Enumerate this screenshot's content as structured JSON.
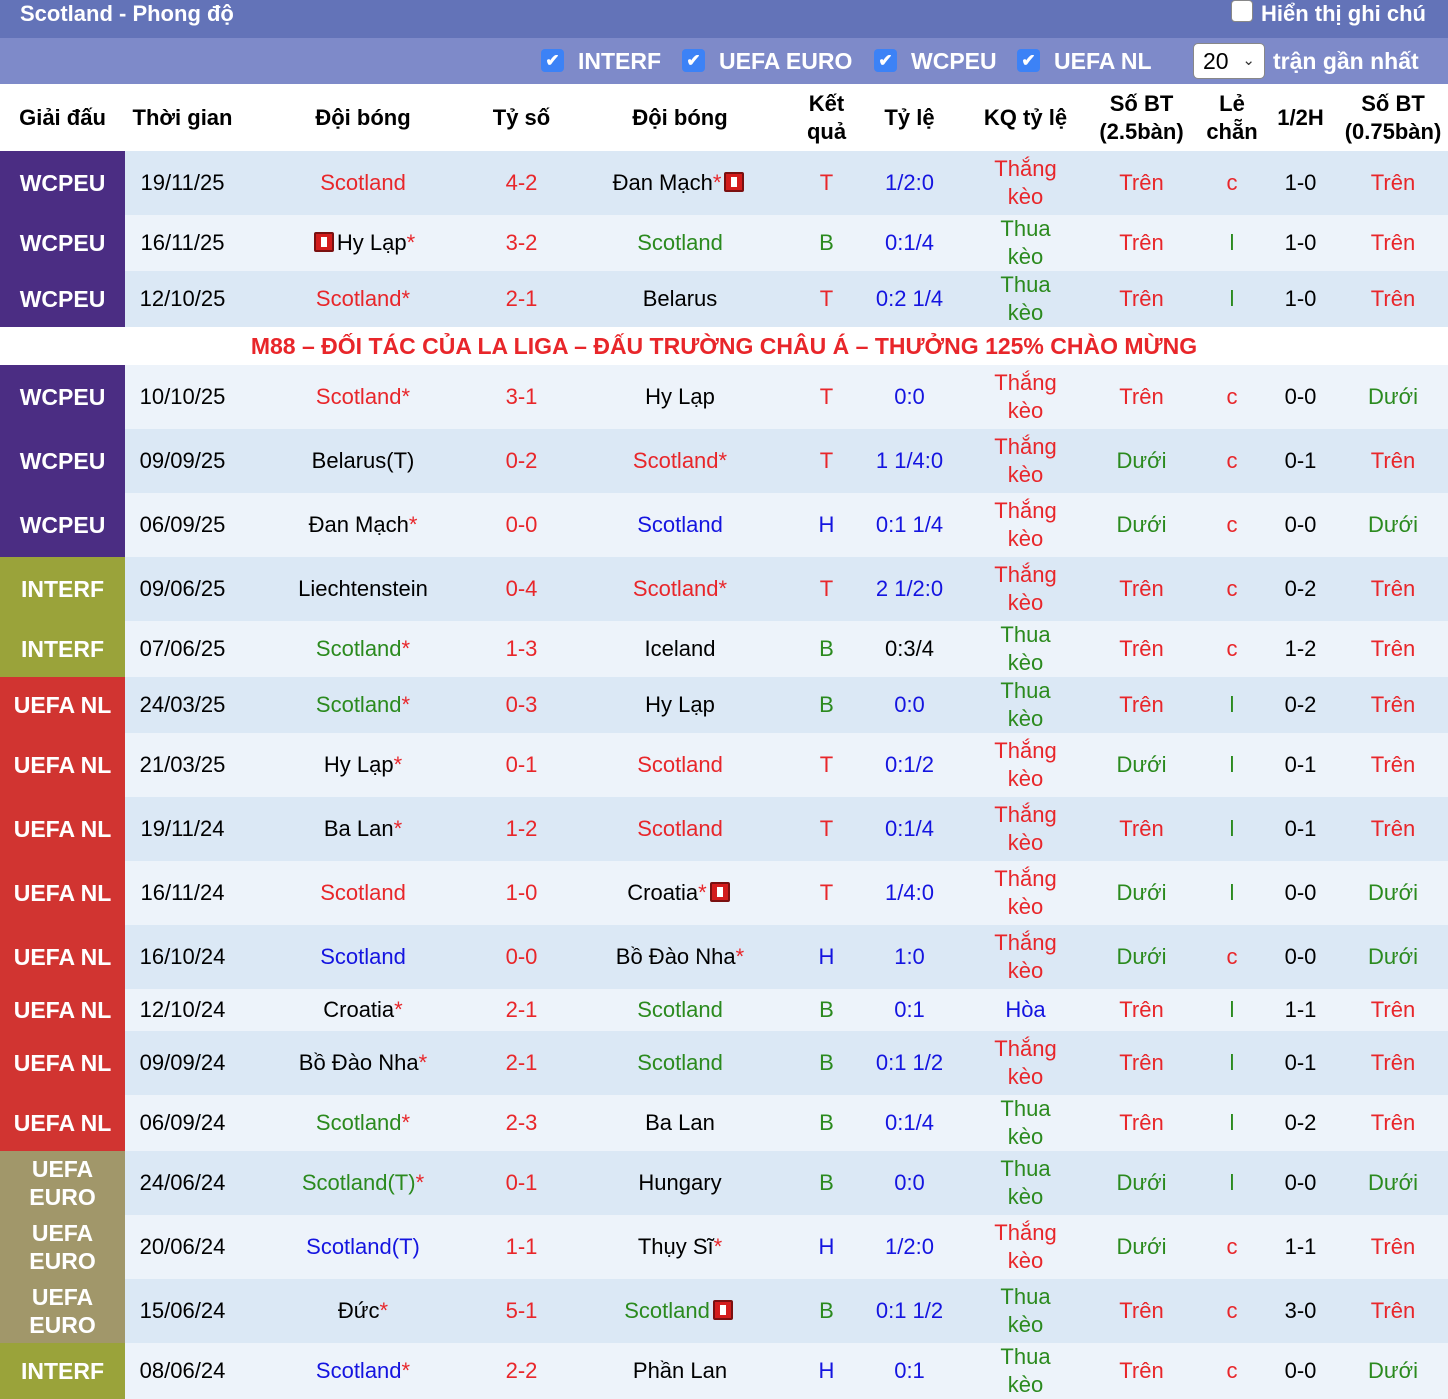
{
  "header": {
    "title": "Scotland - Phong độ",
    "show_notes": "Hiển thị ghi chú"
  },
  "filters": [
    {
      "label": "INTERF",
      "checked": true
    },
    {
      "label": "UEFA EURO",
      "checked": true
    },
    {
      "label": "WCPEU",
      "checked": true
    },
    {
      "label": "UEFA NL",
      "checked": true
    }
  ],
  "recent": {
    "value": "20",
    "label": "trận gần nhất"
  },
  "columns": [
    "Giải đấu",
    "Thời gian",
    "Đội bóng",
    "Tỷ số",
    "Đội bóng",
    "Kết quả",
    "Tỷ lệ",
    "KQ tỷ lệ",
    "Số BT (2.5bàn)",
    "Lẻ chẵn",
    "1/2H",
    "Số BT (0.75bàn)"
  ],
  "colors": {
    "WCPEU": "#4b2d83",
    "INTERF": "#9aa33a",
    "UEFA NL": "#d13431",
    "UEFA EURO": "#a1976a",
    "red": "#e8262a",
    "green": "#2b8a1e",
    "blue": "#1414e0"
  },
  "promo": "M88 – ĐỐI TÁC CỦA LA LIGA – ĐẤU TRƯỜNG CHÂU Á – THƯỞNG 125% CHÀO MỪNG",
  "matches": [
    {
      "comp": "WCPEU",
      "date": "19/11/25",
      "home": "Scotland",
      "hc": "red",
      "hs": "",
      "hcard": false,
      "score": "4-2",
      "away": "Đan Mạch",
      "ac": "black",
      "as": "*",
      "acard": true,
      "res": "T",
      "odds": "1/2:0",
      "oc": "blue",
      "kq": "Thắng kèo",
      "kc": "red",
      "bt": "Trên",
      "btc": "red",
      "lc": "c",
      "h1": "1-0",
      "bt2": "Trên",
      "bt2c": "red"
    },
    {
      "comp": "WCPEU",
      "date": "16/11/25",
      "home": "Hy Lạp",
      "hc": "black",
      "hs": "*",
      "hcard": true,
      "score": "3-2",
      "away": "Scotland",
      "ac": "green",
      "as": "",
      "acard": false,
      "res": "B",
      "odds": "0:1/4",
      "oc": "blue",
      "kq": "Thua kèo",
      "kc": "green",
      "bt": "Trên",
      "btc": "red",
      "lc": "l",
      "h1": "1-0",
      "bt2": "Trên",
      "bt2c": "red"
    },
    {
      "comp": "WCPEU",
      "date": "12/10/25",
      "home": "Scotland",
      "hc": "red",
      "hs": "*",
      "hcard": false,
      "score": "2-1",
      "away": "Belarus",
      "ac": "black",
      "as": "",
      "acard": false,
      "res": "T",
      "odds": "0:2 1/4",
      "oc": "blue",
      "kq": "Thua kèo",
      "kc": "green",
      "bt": "Trên",
      "btc": "red",
      "lc": "l",
      "h1": "1-0",
      "bt2": "Trên",
      "bt2c": "red"
    },
    {
      "comp": "WCPEU",
      "date": "10/10/25",
      "home": "Scotland",
      "hc": "red",
      "hs": "*",
      "hcard": false,
      "score": "3-1",
      "away": "Hy Lạp",
      "ac": "black",
      "as": "",
      "acard": false,
      "res": "T",
      "odds": "0:0",
      "oc": "blue",
      "kq": "Thắng kèo",
      "kc": "red",
      "bt": "Trên",
      "btc": "red",
      "lc": "c",
      "h1": "0-0",
      "bt2": "Dưới",
      "bt2c": "green"
    },
    {
      "comp": "WCPEU",
      "date": "09/09/25",
      "home": "Belarus(T)",
      "hc": "black",
      "hs": "",
      "hcard": false,
      "score": "0-2",
      "away": "Scotland",
      "ac": "red",
      "as": "*",
      "acard": false,
      "res": "T",
      "odds": "1 1/4:0",
      "oc": "blue",
      "kq": "Thắng kèo",
      "kc": "red",
      "bt": "Dưới",
      "btc": "green",
      "lc": "c",
      "h1": "0-1",
      "bt2": "Trên",
      "bt2c": "red"
    },
    {
      "comp": "WCPEU",
      "date": "06/09/25",
      "home": "Đan Mạch",
      "hc": "black",
      "hs": "*",
      "hcard": false,
      "score": "0-0",
      "away": "Scotland",
      "ac": "blue",
      "as": "",
      "acard": false,
      "res": "H",
      "odds": "0:1 1/4",
      "oc": "blue",
      "kq": "Thắng kèo",
      "kc": "red",
      "bt": "Dưới",
      "btc": "green",
      "lc": "c",
      "h1": "0-0",
      "bt2": "Dưới",
      "bt2c": "green"
    },
    {
      "comp": "INTERF",
      "date": "09/06/25",
      "home": "Liechtenstein",
      "hc": "black",
      "hs": "",
      "hcard": false,
      "score": "0-4",
      "away": "Scotland",
      "ac": "red",
      "as": "*",
      "acard": false,
      "res": "T",
      "odds": "2 1/2:0",
      "oc": "blue",
      "kq": "Thắng kèo",
      "kc": "red",
      "bt": "Trên",
      "btc": "red",
      "lc": "c",
      "h1": "0-2",
      "bt2": "Trên",
      "bt2c": "red"
    },
    {
      "comp": "INTERF",
      "date": "07/06/25",
      "home": "Scotland",
      "hc": "green",
      "hs": "*",
      "hcard": false,
      "score": "1-3",
      "away": "Iceland",
      "ac": "black",
      "as": "",
      "acard": false,
      "res": "B",
      "odds": "0:3/4",
      "oc": "black",
      "kq": "Thua kèo",
      "kc": "green",
      "bt": "Trên",
      "btc": "red",
      "lc": "c",
      "h1": "1-2",
      "bt2": "Trên",
      "bt2c": "red"
    },
    {
      "comp": "UEFA NL",
      "date": "24/03/25",
      "home": "Scotland",
      "hc": "green",
      "hs": "*",
      "hcard": false,
      "score": "0-3",
      "away": "Hy Lạp",
      "ac": "black",
      "as": "",
      "acard": false,
      "res": "B",
      "odds": "0:0",
      "oc": "blue",
      "kq": "Thua kèo",
      "kc": "green",
      "bt": "Trên",
      "btc": "red",
      "lc": "l",
      "h1": "0-2",
      "bt2": "Trên",
      "bt2c": "red"
    },
    {
      "comp": "UEFA NL",
      "date": "21/03/25",
      "home": "Hy Lạp",
      "hc": "black",
      "hs": "*",
      "hcard": false,
      "score": "0-1",
      "away": "Scotland",
      "ac": "red",
      "as": "",
      "acard": false,
      "res": "T",
      "odds": "0:1/2",
      "oc": "blue",
      "kq": "Thắng kèo",
      "kc": "red",
      "bt": "Dưới",
      "btc": "green",
      "lc": "l",
      "h1": "0-1",
      "bt2": "Trên",
      "bt2c": "red"
    },
    {
      "comp": "UEFA NL",
      "date": "19/11/24",
      "home": "Ba Lan",
      "hc": "black",
      "hs": "*",
      "hcard": false,
      "score": "1-2",
      "away": "Scotland",
      "ac": "red",
      "as": "",
      "acard": false,
      "res": "T",
      "odds": "0:1/4",
      "oc": "blue",
      "kq": "Thắng kèo",
      "kc": "red",
      "bt": "Trên",
      "btc": "red",
      "lc": "l",
      "h1": "0-1",
      "bt2": "Trên",
      "bt2c": "red"
    },
    {
      "comp": "UEFA NL",
      "date": "16/11/24",
      "home": "Scotland",
      "hc": "red",
      "hs": "",
      "hcard": false,
      "score": "1-0",
      "away": "Croatia",
      "ac": "black",
      "as": "*",
      "acard": true,
      "res": "T",
      "odds": "1/4:0",
      "oc": "blue",
      "kq": "Thắng kèo",
      "kc": "red",
      "bt": "Dưới",
      "btc": "green",
      "lc": "l",
      "h1": "0-0",
      "bt2": "Dưới",
      "bt2c": "green"
    },
    {
      "comp": "UEFA NL",
      "date": "16/10/24",
      "home": "Scotland",
      "hc": "blue",
      "hs": "",
      "hcard": false,
      "score": "0-0",
      "away": "Bồ Đào Nha",
      "ac": "black",
      "as": "*",
      "acard": false,
      "res": "H",
      "odds": "1:0",
      "oc": "blue",
      "kq": "Thắng kèo",
      "kc": "red",
      "bt": "Dưới",
      "btc": "green",
      "lc": "c",
      "h1": "0-0",
      "bt2": "Dưới",
      "bt2c": "green"
    },
    {
      "comp": "UEFA NL",
      "date": "12/10/24",
      "home": "Croatia",
      "hc": "black",
      "hs": "*",
      "hcard": false,
      "score": "2-1",
      "away": "Scotland",
      "ac": "green",
      "as": "",
      "acard": false,
      "res": "B",
      "odds": "0:1",
      "oc": "blue",
      "kq": "Hòa",
      "kc": "blue",
      "bt": "Trên",
      "btc": "red",
      "lc": "l",
      "h1": "1-1",
      "bt2": "Trên",
      "bt2c": "red"
    },
    {
      "comp": "UEFA NL",
      "date": "09/09/24",
      "home": "Bồ Đào Nha",
      "hc": "black",
      "hs": "*",
      "hcard": false,
      "score": "2-1",
      "away": "Scotland",
      "ac": "green",
      "as": "",
      "acard": false,
      "res": "B",
      "odds": "0:1 1/2",
      "oc": "blue",
      "kq": "Thắng kèo",
      "kc": "red",
      "bt": "Trên",
      "btc": "red",
      "lc": "l",
      "h1": "0-1",
      "bt2": "Trên",
      "bt2c": "red"
    },
    {
      "comp": "UEFA NL",
      "date": "06/09/24",
      "home": "Scotland",
      "hc": "green",
      "hs": "*",
      "hcard": false,
      "score": "2-3",
      "away": "Ba Lan",
      "ac": "black",
      "as": "",
      "acard": false,
      "res": "B",
      "odds": "0:1/4",
      "oc": "blue",
      "kq": "Thua kèo",
      "kc": "green",
      "bt": "Trên",
      "btc": "red",
      "lc": "l",
      "h1": "0-2",
      "bt2": "Trên",
      "bt2c": "red"
    },
    {
      "comp": "UEFA EURO",
      "date": "24/06/24",
      "home": "Scotland(T)",
      "hc": "green",
      "hs": "*",
      "hcard": false,
      "score": "0-1",
      "away": "Hungary",
      "ac": "black",
      "as": "",
      "acard": false,
      "res": "B",
      "odds": "0:0",
      "oc": "blue",
      "kq": "Thua kèo",
      "kc": "green",
      "bt": "Dưới",
      "btc": "green",
      "lc": "l",
      "h1": "0-0",
      "bt2": "Dưới",
      "bt2c": "green"
    },
    {
      "comp": "UEFA EURO",
      "date": "20/06/24",
      "home": "Scotland(T)",
      "hc": "blue",
      "hs": "",
      "hcard": false,
      "score": "1-1",
      "away": "Thụy Sĩ",
      "ac": "black",
      "as": "*",
      "acard": false,
      "res": "H",
      "odds": "1/2:0",
      "oc": "blue",
      "kq": "Thắng kèo",
      "kc": "red",
      "bt": "Dưới",
      "btc": "green",
      "lc": "c",
      "h1": "1-1",
      "bt2": "Trên",
      "bt2c": "red"
    },
    {
      "comp": "UEFA EURO",
      "date": "15/06/24",
      "home": "Đức",
      "hc": "black",
      "hs": "*",
      "hcard": false,
      "score": "5-1",
      "away": "Scotland",
      "ac": "green",
      "as": "",
      "acard": true,
      "res": "B",
      "odds": "0:1 1/2",
      "oc": "blue",
      "kq": "Thua kèo",
      "kc": "green",
      "bt": "Trên",
      "btc": "red",
      "lc": "c",
      "h1": "3-0",
      "bt2": "Trên",
      "bt2c": "red"
    },
    {
      "comp": "INTERF",
      "date": "08/06/24",
      "home": "Scotland",
      "hc": "blue",
      "hs": "*",
      "hcard": false,
      "score": "2-2",
      "away": "Phần Lan",
      "ac": "black",
      "as": "",
      "acard": false,
      "res": "H",
      "odds": "0:1",
      "oc": "blue",
      "kq": "Thua kèo",
      "kc": "green",
      "bt": "Trên",
      "btc": "red",
      "lc": "c",
      "h1": "0-0",
      "bt2": "Dưới",
      "bt2c": "green"
    }
  ]
}
